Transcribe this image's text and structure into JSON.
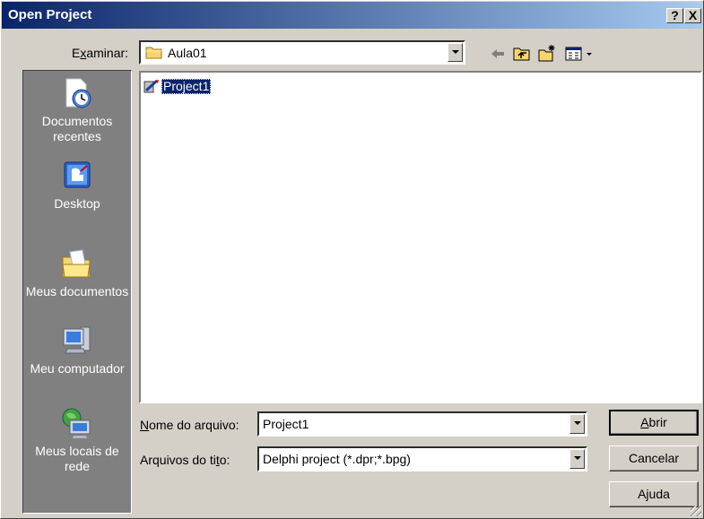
{
  "title": "Open Project",
  "help_glyph": "?",
  "close_glyph": "X",
  "look_in": {
    "label": "Examinar:",
    "value": "Aula01"
  },
  "places": [
    {
      "label": "Documentos recentes",
      "icon": "recent-documents-icon"
    },
    {
      "label": "Desktop",
      "icon": "desktop-icon"
    },
    {
      "label": "Meus documentos",
      "icon": "my-documents-icon"
    },
    {
      "label": "Meu computador",
      "icon": "my-computer-icon"
    },
    {
      "label": "Meus locais de rede",
      "icon": "network-places-icon"
    }
  ],
  "files": [
    {
      "name": "Project1",
      "icon": "delphi-project-icon",
      "selected": true
    }
  ],
  "filename": {
    "label": "Nome do arquivo:",
    "value": "Project1"
  },
  "filetype": {
    "label": "Arquivos do tipo:",
    "value": "Delphi project (*.dpr;*.bpg)"
  },
  "buttons": {
    "open": "Abrir",
    "cancel": "Cancelar",
    "help": "Ajuda"
  },
  "colors": {
    "titlebar_start": "#0a246a",
    "titlebar_end": "#a6caf0",
    "places_bg": "#808080",
    "selection": "#0a246a",
    "face": "#d4d0c8"
  }
}
